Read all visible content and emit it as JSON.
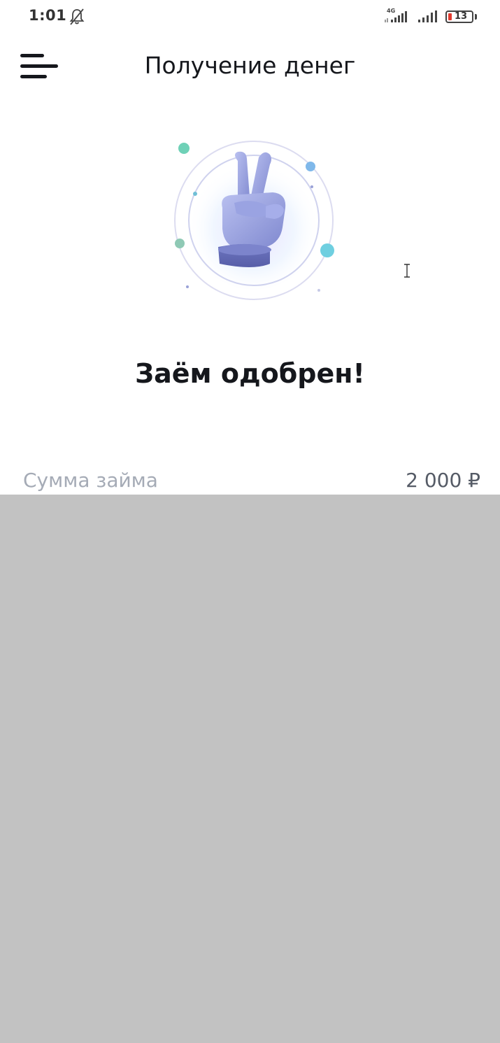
{
  "status_bar": {
    "time": "1:01",
    "network_label": "4G",
    "battery_level": "13",
    "icons": [
      "bell-off-icon",
      "signal-icon",
      "signal-icon",
      "battery-icon"
    ]
  },
  "header": {
    "title": "Получение денег",
    "menu_icon": "hamburger-menu-icon"
  },
  "main": {
    "illustration_icon": "victory-hand-icon",
    "approval_title": "Заём одобрен!",
    "loan_amount_label": "Сумма займа",
    "loan_amount_value": "2 000 ₽"
  },
  "colors": {
    "text_primary": "#15171c",
    "text_muted": "#a5abb6",
    "overlay": "#c2c2c2",
    "accent_teal": "#6fd1b7",
    "accent_blue": "#7fb8ea",
    "hand": "#8f97d6"
  }
}
